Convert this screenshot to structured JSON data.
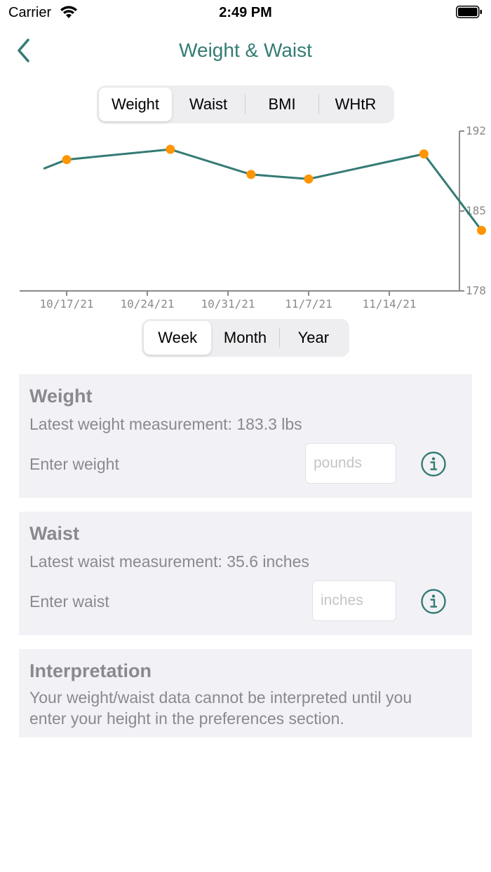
{
  "status_bar": {
    "carrier": "Carrier",
    "time": "2:49 PM"
  },
  "nav": {
    "title": "Weight & Waist",
    "back_icon": "chevron-left-icon"
  },
  "metric_tabs": [
    {
      "label": "Weight",
      "selected": true
    },
    {
      "label": "Waist",
      "selected": false
    },
    {
      "label": "BMI",
      "selected": false
    },
    {
      "label": "WHtR",
      "selected": false
    }
  ],
  "range_tabs": [
    {
      "label": "Week",
      "selected": true
    },
    {
      "label": "Month",
      "selected": false
    },
    {
      "label": "Year",
      "selected": false
    }
  ],
  "chart_data": {
    "type": "line",
    "x_ticks": [
      "10/17/21",
      "10/24/21",
      "10/31/21",
      "11/7/21",
      "11/14/21"
    ],
    "y_ticks": [
      "192",
      "185",
      "178"
    ],
    "ylim": [
      178,
      192
    ],
    "series": [
      {
        "values": [
          {
            "day": -2,
            "y": 188.7
          },
          {
            "day": 0,
            "y": 189.5
          },
          {
            "day": 9,
            "y": 190.4
          },
          {
            "day": 16,
            "y": 188.2
          },
          {
            "day": 21,
            "y": 187.8
          },
          {
            "day": 31,
            "y": 190.0
          },
          {
            "day": 36,
            "y": 183.3
          }
        ]
      }
    ],
    "line_color": "#347b75",
    "marker_color": "#ff9500",
    "axis_color": "#8a8a8a"
  },
  "weight_card": {
    "title": "Weight",
    "latest": "Latest weight measurement: 183.3 lbs",
    "input_label": "Enter weight",
    "placeholder": "pounds",
    "info_icon": "info-circle-icon"
  },
  "waist_card": {
    "title": "Waist",
    "latest": "Latest waist measurement: 35.6 inches",
    "input_label": "Enter waist",
    "placeholder": "inches",
    "info_icon": "info-circle-icon"
  },
  "interpretation_card": {
    "title": "Interpretation",
    "body": "Your weight/waist data cannot be interpreted until you enter your height in the preferences section."
  },
  "colors": {
    "accent": "#347b75",
    "secondary_text": "#8a8a8e",
    "card_bg": "#f2f2f6"
  }
}
